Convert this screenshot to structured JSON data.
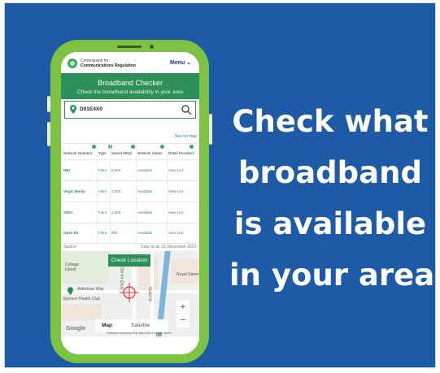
{
  "headline": {
    "lines": [
      "Check what",
      "broadband",
      "is available",
      "in your area"
    ]
  },
  "app": {
    "org_line1": "Commission for",
    "org_line2": "Communications Regulation",
    "menu_label": "Menu ⌄",
    "title": "Broadband Checker",
    "subtitle": "Check the broadband availability in your area",
    "search_value": "D01E4X0",
    "see_on_map": "See on map",
    "table": {
      "headers": [
        "Network Operator",
        "Type",
        "Speed Mbps",
        "Network Status",
        "Retail Providers"
      ],
      "rows": [
        {
          "operator": "NBI",
          "type": "Fibre",
          "speed": "5,000",
          "status": "Available",
          "retail": "View List"
        },
        {
          "operator": "Virgin Media",
          "type": "Fibre",
          "speed": "2,000",
          "status": "Available",
          "retail": "View List"
        },
        {
          "operator": "SIRO",
          "type": "Fibre",
          "speed": "1,000",
          "status": "Available",
          "retail": "View List"
        },
        {
          "operator": "Open Eir",
          "type": "Fibre",
          "speed": "900",
          "status": "Available",
          "retail": "View List"
        }
      ]
    },
    "source_label": "Source",
    "data_as_at": "Data as at: 31 December 2023",
    "map": {
      "check_location": "Check Location",
      "labels": [
        "College Island",
        "Alderman Way",
        "Spencer Health Club",
        "Royal Street",
        "Guild St",
        "Clarion Quay"
      ],
      "map_tab": "Map",
      "satellite_tab": "Satellite",
      "zoom_in": "+",
      "zoom_out": "−",
      "google": "Google",
      "attribution": "Keyboard shortcuts   Map data ©2024 Google   Terms"
    }
  },
  "colors": {
    "background": "#1f5aa6",
    "phone": "#7dc242",
    "accent": "#2f8f5a"
  }
}
